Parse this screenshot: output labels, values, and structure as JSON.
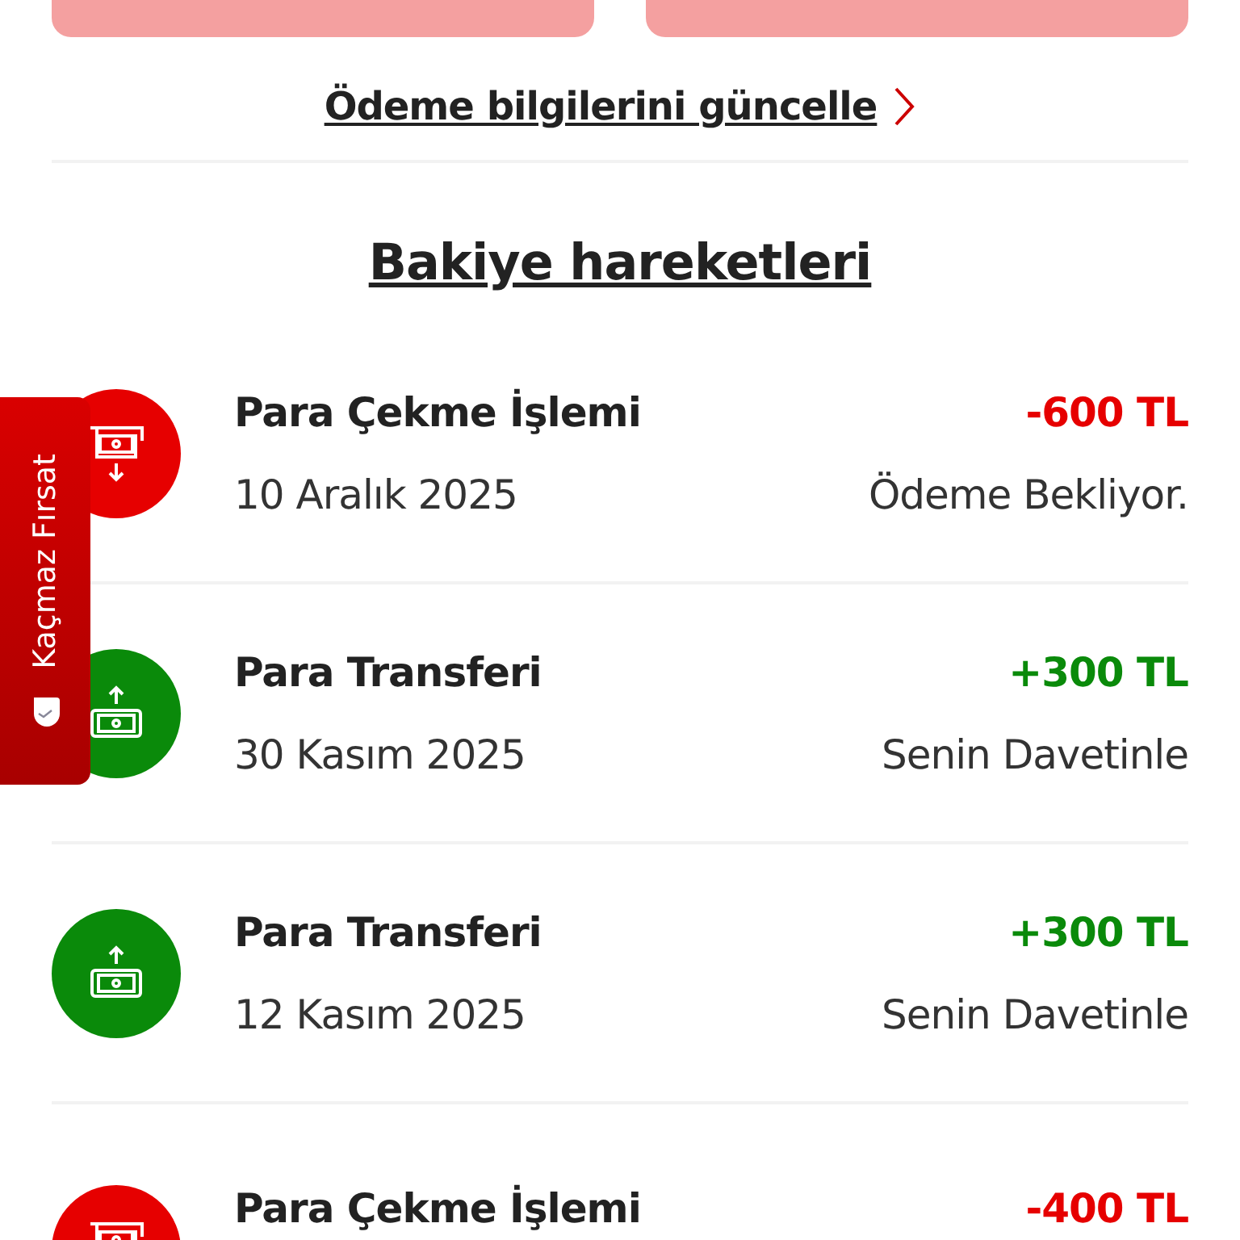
{
  "payment_link": {
    "label": "Ödeme bilgilerini güncelle"
  },
  "section_title": "Bakiye hareketleri",
  "transactions": [
    {
      "kind": "withdrawal",
      "title": "Para Çekme İşlemi",
      "amount": "-600 TL",
      "date": "10 Aralık 2025",
      "status": "Ödeme Bekliyor."
    },
    {
      "kind": "transfer",
      "title": "Para Transferi",
      "amount": "+300 TL",
      "date": "30 Kasım 2025",
      "status": "Senin Davetinle"
    },
    {
      "kind": "transfer",
      "title": "Para Transferi",
      "amount": "+300 TL",
      "date": "12 Kasım 2025",
      "status": "Senin Davetinle"
    },
    {
      "kind": "withdrawal",
      "title": "Para Çekme İşlemi",
      "amount": "-400 TL"
    }
  ],
  "side_tab": {
    "label": "Kaçmaz Fırsat"
  }
}
